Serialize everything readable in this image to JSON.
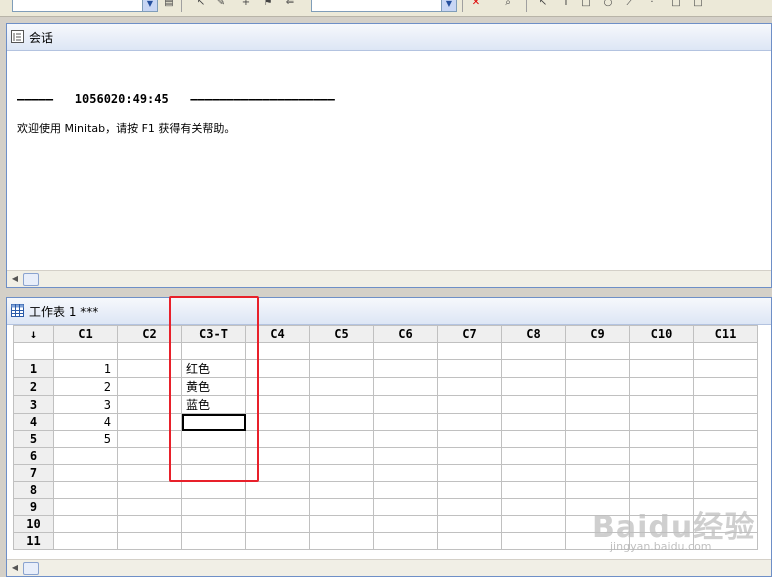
{
  "session": {
    "title": "会话",
    "line1": "—————   1056020:49:45   ————————————————————",
    "line2": "欢迎使用 Minitab，请按 F1 获得有关帮助。"
  },
  "worksheet": {
    "title": "工作表 1 ***",
    "corner": "↓",
    "columns": [
      "C1",
      "C2",
      "C3-T",
      "C4",
      "C5",
      "C6",
      "C7",
      "C8",
      "C9",
      "C10",
      "C11"
    ],
    "rows": [
      {
        "label": "1",
        "c1": "1",
        "c3": "红色"
      },
      {
        "label": "2",
        "c1": "2",
        "c3": "黄色"
      },
      {
        "label": "3",
        "c1": "3",
        "c3": "蓝色"
      },
      {
        "label": "4",
        "c1": "4",
        "c3": ""
      },
      {
        "label": "5",
        "c1": "5",
        "c3": ""
      },
      {
        "label": "6",
        "c1": "",
        "c3": ""
      },
      {
        "label": "7",
        "c1": "",
        "c3": ""
      },
      {
        "label": "8",
        "c1": "",
        "c3": ""
      },
      {
        "label": "9",
        "c1": "",
        "c3": ""
      },
      {
        "label": "10",
        "c1": "",
        "c3": ""
      },
      {
        "label": "11",
        "c1": "",
        "c3": ""
      }
    ],
    "active_cell": "C3-T row 4"
  },
  "watermark": {
    "main": "Baidu经验",
    "sub": "jingyan.baidu.com"
  },
  "colors": {
    "highlight": "#e8202a",
    "window_border": "#6e8fc7",
    "header_bg": "#efefef"
  }
}
